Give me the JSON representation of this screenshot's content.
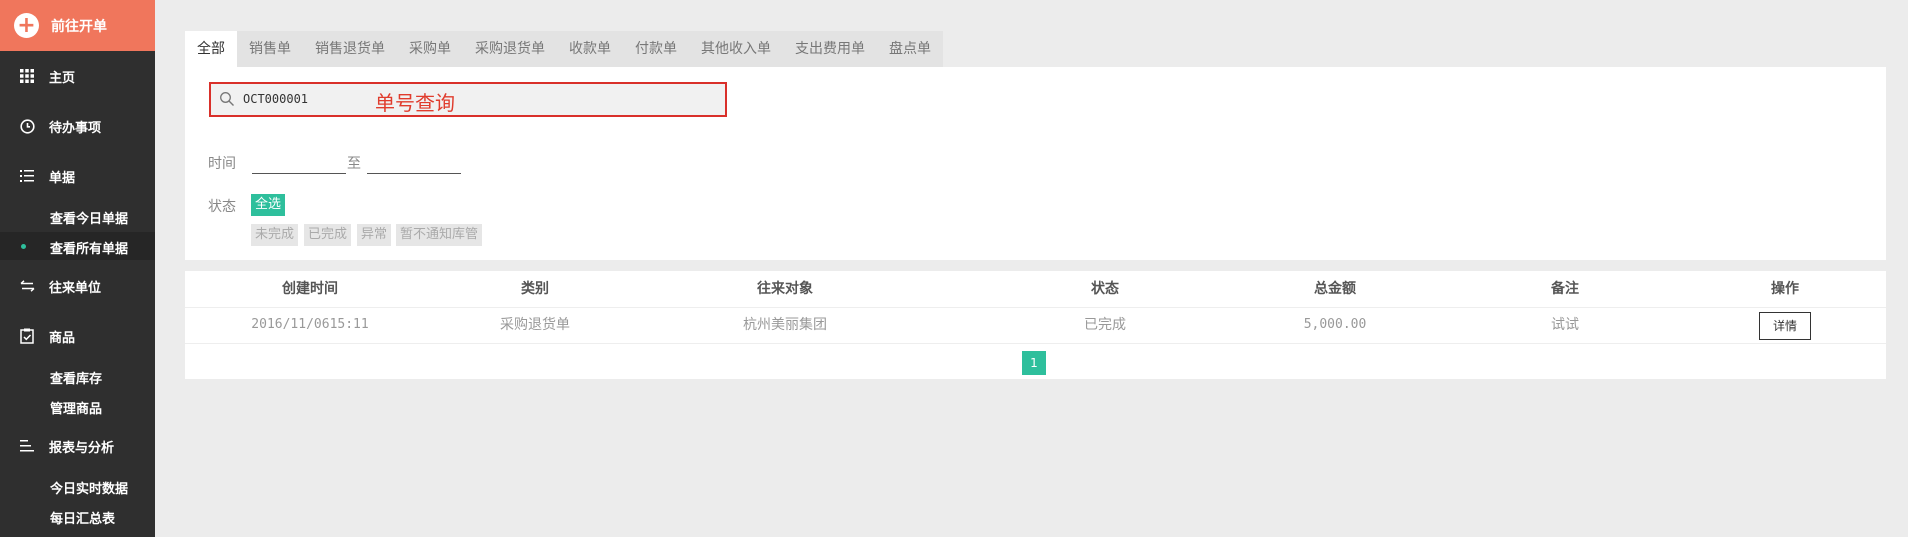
{
  "sidebar": {
    "new_order_label": "前往开单",
    "items": [
      {
        "label": "主页",
        "icon": "grid-icon"
      },
      {
        "label": "待办事项",
        "icon": "clock-icon"
      },
      {
        "label": "单据",
        "icon": "list-icon"
      },
      {
        "label": "往来单位",
        "icon": "exchange-icon"
      },
      {
        "label": "商品",
        "icon": "clipboard-check-icon"
      },
      {
        "label": "报表与分析",
        "icon": "report-icon"
      }
    ],
    "subitems": {
      "docs_today": "查看今日单据",
      "docs_all": "查看所有单据",
      "stock_view": "查看库存",
      "goods_manage": "管理商品",
      "report_today": "今日实时数据",
      "report_daily": "每日汇总表"
    },
    "active_subitem": "查看所有单据",
    "colors": {
      "background": "#2f2f2f",
      "accent": "#f0765c",
      "active_dot": "#2ebf9c"
    }
  },
  "tabs": [
    "全部",
    "销售单",
    "销售退货单",
    "采购单",
    "采购退货单",
    "收款单",
    "付款单",
    "其他收入单",
    "支出费用单",
    "盘点单"
  ],
  "active_tab": "全部",
  "filter": {
    "search_value": "OCT000001",
    "search_annotation": "单号查询",
    "time_label": "时间",
    "to_label": "至",
    "status_label": "状态",
    "status_chips": [
      "全选",
      "未完成",
      "已完成",
      "异常",
      "暂不通知库管"
    ],
    "selected_chip": "全选"
  },
  "table": {
    "headers": [
      "创建时间",
      "类别",
      "往来对象",
      "状态",
      "总金额",
      "备注",
      "操作"
    ],
    "rows": [
      {
        "created": "2016/11/0615:11",
        "category": "采购退货单",
        "partner": "杭州美丽集团",
        "status": "已完成",
        "amount": "5,000.00",
        "remark": "试试",
        "action": "详情"
      }
    ]
  },
  "pagination": {
    "current": "1"
  },
  "colors": {
    "accent_green": "#2ebf9c",
    "highlight_red": "#d9302a"
  }
}
